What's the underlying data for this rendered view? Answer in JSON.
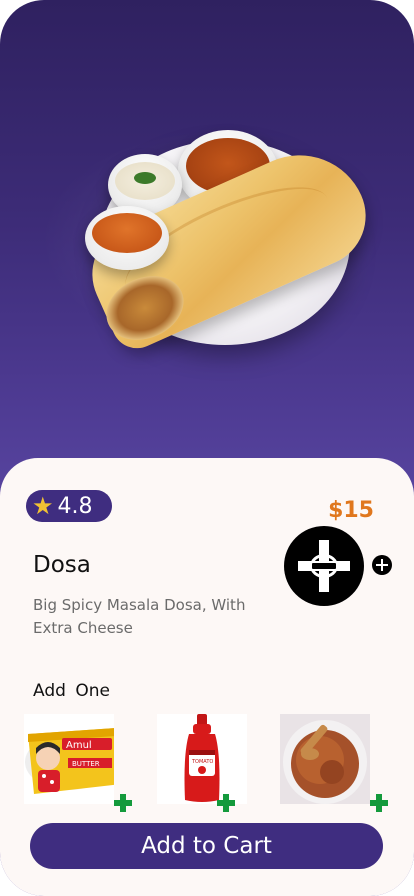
{
  "product": {
    "rating": "4.8",
    "price": "$15",
    "name": "Dosa",
    "description": "Big Spicy Masala Dosa, With Extra Cheese"
  },
  "addons": {
    "title": "Add  One",
    "items": [
      {
        "icon": "amul-butter-image"
      },
      {
        "icon": "ketchup-bottle-image"
      },
      {
        "icon": "masala-powder-bowl-image"
      }
    ]
  },
  "cart": {
    "label": "Add to Cart"
  },
  "colors": {
    "header_gradient_top": "#2f2160",
    "header_gradient_bottom": "#5e4ca8",
    "accent": "#3f2d80",
    "price": "#e0771d",
    "star": "#f2c233",
    "addon_plus": "#149a3c",
    "card_bg": "#fdf8f6"
  }
}
